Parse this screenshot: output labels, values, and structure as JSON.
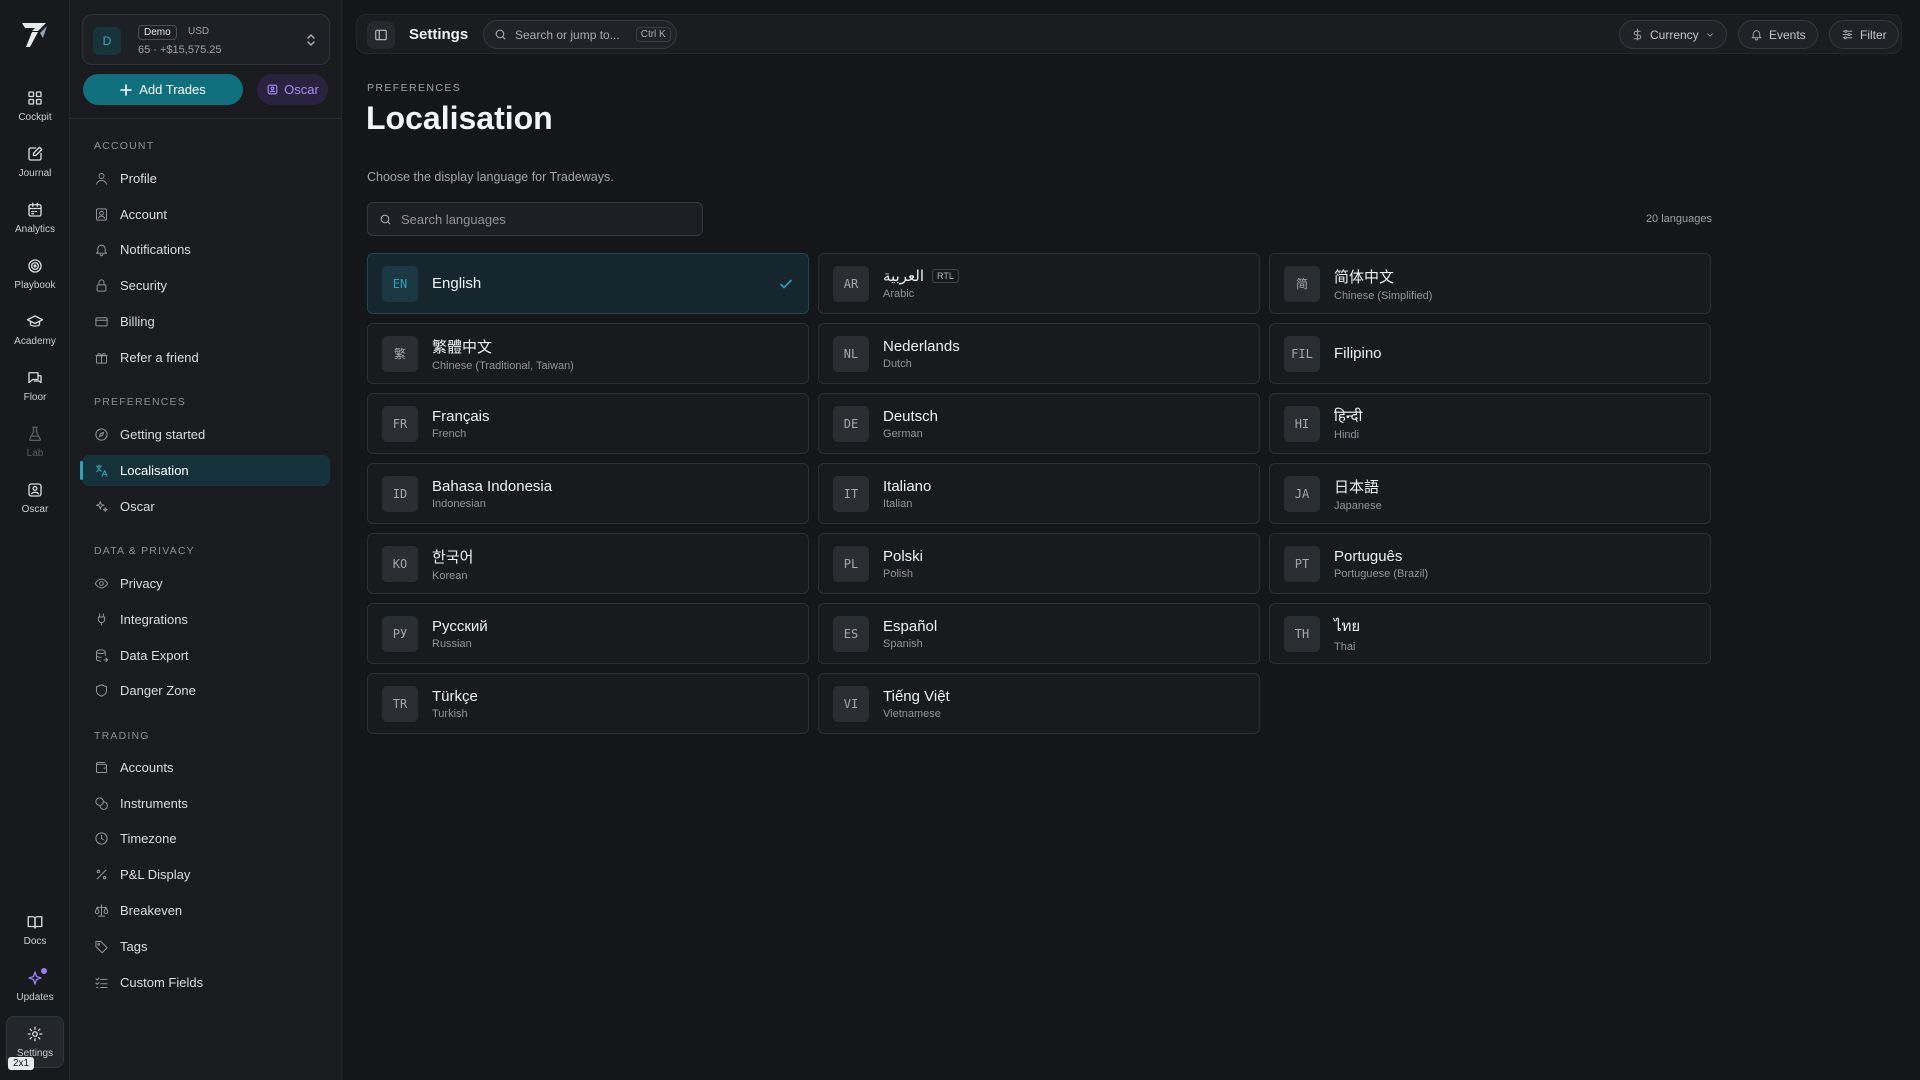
{
  "rail": {
    "items": [
      {
        "label": "Cockpit",
        "icon": "grid-icon"
      },
      {
        "label": "Journal",
        "icon": "journal-icon"
      },
      {
        "label": "Analytics",
        "icon": "calendar-icon"
      },
      {
        "label": "Playbook",
        "icon": "target-icon"
      },
      {
        "label": "Academy",
        "icon": "graduation-cap-icon"
      },
      {
        "label": "Floor",
        "icon": "chat-icon"
      },
      {
        "label": "Lab",
        "icon": "flask-icon"
      },
      {
        "label": "Oscar",
        "icon": "robot-icon"
      },
      {
        "label": "Docs",
        "icon": "book-icon"
      },
      {
        "label": "Updates",
        "icon": "sparkle-icon"
      },
      {
        "label": "Settings",
        "icon": "gear-icon"
      }
    ],
    "badge": "2x1"
  },
  "account": {
    "avatar": "D",
    "tag": "Demo",
    "currency": "USD",
    "balance": "65 · +$15,575.25"
  },
  "actions": {
    "add_trades": "Add Trades",
    "oscar": "Oscar"
  },
  "sidebar": {
    "sections": [
      {
        "title": "ACCOUNT",
        "items": [
          "Profile",
          "Account",
          "Notifications",
          "Security",
          "Billing",
          "Refer a friend"
        ]
      },
      {
        "title": "PREFERENCES",
        "items": [
          "Getting started",
          "Localisation",
          "Oscar"
        ]
      },
      {
        "title": "DATA & PRIVACY",
        "items": [
          "Privacy",
          "Integrations",
          "Data Export",
          "Danger Zone"
        ]
      },
      {
        "title": "TRADING",
        "items": [
          "Accounts",
          "Instruments",
          "Timezone",
          "P&L Display",
          "Breakeven",
          "Tags",
          "Custom Fields"
        ]
      }
    ],
    "active": "Localisation"
  },
  "topbar": {
    "title": "Settings",
    "search_placeholder": "Search or jump to...",
    "shortcut": "Ctrl K",
    "currency": "Currency",
    "events": "Events",
    "filter": "Filter"
  },
  "main": {
    "eyebrow": "PREFERENCES",
    "title": "Localisation",
    "description": "Choose the display language for Tradeways.",
    "search_placeholder": "Search languages",
    "count": "20 languages",
    "rtl_label": "RTL",
    "languages": [
      {
        "code": "EN",
        "native": "English",
        "english": "",
        "selected": true
      },
      {
        "code": "AR",
        "native": "العربية",
        "english": "Arabic",
        "rtl": true
      },
      {
        "code": "简",
        "native": "简体中文",
        "english": "Chinese (Simplified)"
      },
      {
        "code": "繁",
        "native": "繁體中文",
        "english": "Chinese (Traditional, Taiwan)"
      },
      {
        "code": "NL",
        "native": "Nederlands",
        "english": "Dutch"
      },
      {
        "code": "FIL",
        "native": "Filipino",
        "english": ""
      },
      {
        "code": "FR",
        "native": "Français",
        "english": "French"
      },
      {
        "code": "DE",
        "native": "Deutsch",
        "english": "German"
      },
      {
        "code": "HI",
        "native": "हिन्दी",
        "english": "Hindi"
      },
      {
        "code": "ID",
        "native": "Bahasa Indonesia",
        "english": "Indonesian"
      },
      {
        "code": "IT",
        "native": "Italiano",
        "english": "Italian"
      },
      {
        "code": "JA",
        "native": "日本語",
        "english": "Japanese"
      },
      {
        "code": "KO",
        "native": "한국어",
        "english": "Korean"
      },
      {
        "code": "PL",
        "native": "Polski",
        "english": "Polish"
      },
      {
        "code": "PT",
        "native": "Português",
        "english": "Portuguese (Brazil)"
      },
      {
        "code": "РУ",
        "native": "Русский",
        "english": "Russian"
      },
      {
        "code": "ES",
        "native": "Español",
        "english": "Spanish"
      },
      {
        "code": "TH",
        "native": "ไทย",
        "english": "Thai"
      },
      {
        "code": "TR",
        "native": "Türkçe",
        "english": "Turkish"
      },
      {
        "code": "VI",
        "native": "Tiếng Việt",
        "english": "Vietnamese"
      }
    ]
  },
  "colors": {
    "accent": "#2ba3b6",
    "primary_button": "#0f6f7d",
    "oscar_purple": "#a98cf6",
    "background": "#141619"
  }
}
